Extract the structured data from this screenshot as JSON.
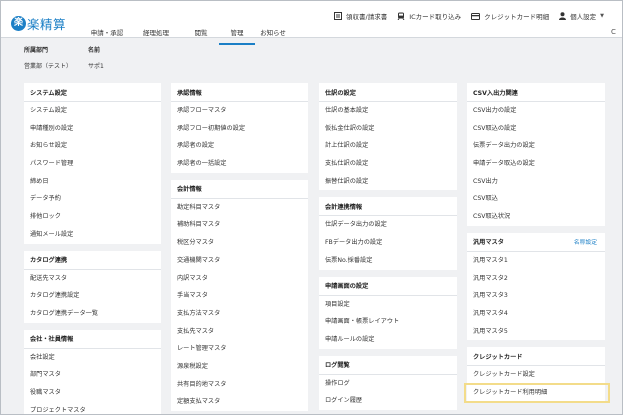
{
  "app": {
    "logo_mark": "楽",
    "logo_text": "楽精算"
  },
  "main_nav": [
    {
      "label": "申請・承認"
    },
    {
      "label": "経理処理"
    },
    {
      "label": "閲覧"
    },
    {
      "label": "管理",
      "active": true
    },
    {
      "label": "お知らせ"
    }
  ],
  "top_links": {
    "receipts": "領収書/請求書",
    "ic_card": "ICカード取り込み",
    "credit_card": "クレジットカード明細",
    "personal": "個人設定"
  },
  "refresh_icon": "C",
  "user_info": {
    "dept_label": "所属部門",
    "name_label": "名前",
    "dept_value": "営業部（テスト）",
    "name_value": "サポ1"
  },
  "columns": [
    {
      "panels": [
        {
          "title": "システム設定",
          "items": [
            "システム設定",
            "申請種別の設定",
            "お知らせ設定",
            "パスワード管理",
            "締め日",
            "データ予約",
            "排他ロック",
            "通知メール設定"
          ]
        },
        {
          "title": "カタログ連携",
          "items": [
            "配送先マスタ",
            "カタログ連携設定",
            "カタログ連携データ一覧"
          ]
        },
        {
          "title": "会社・社員情報",
          "items": [
            "会社設定",
            "部門マスタ",
            "役職マスタ",
            "プロジェクトマスタ"
          ]
        }
      ]
    },
    {
      "panels": [
        {
          "title": "承認情報",
          "items": [
            "承認フローマスタ",
            "承認フロー初期値の設定",
            "承認者の設定",
            "承認者の一括設定"
          ]
        },
        {
          "title": "会計情報",
          "items": [
            "勘定科目マスタ",
            "補助科目マスタ",
            "税区分マスタ",
            "交通機関マスタ",
            "内訳マスタ",
            "手当マスタ",
            "支払方法マスタ",
            "支払先マスタ",
            "レート管理マスタ",
            "源泉税設定",
            "共有目的地マスタ",
            "定額支払マスタ"
          ]
        }
      ]
    },
    {
      "panels": [
        {
          "title": "仕訳の設定",
          "items": [
            "仕訳の基本設定",
            "仮払金仕訳の設定",
            "計上仕訳の設定",
            "支払仕訳の設定",
            "振替仕訳の設定"
          ]
        },
        {
          "title": "会計連携情報",
          "items": [
            "仕訳データ出力の設定",
            "FBデータ出力の設定",
            "伝票No.採番設定"
          ]
        },
        {
          "title": "申請画面の設定",
          "items": [
            "項目設定",
            "申請画面・帳票レイアウト",
            "申請ルールの設定"
          ]
        },
        {
          "title": "ログ閲覧",
          "items": [
            "操作ログ",
            "ログイン履歴"
          ]
        }
      ]
    },
    {
      "panels": [
        {
          "title": "CSV入出力関連",
          "items": [
            "CSV出力の設定",
            "CSV取込の設定",
            "伝票データ出力の設定",
            "申請データ取込の設定",
            "CSV出力",
            "CSV取込",
            "CSV取込状況"
          ]
        },
        {
          "title": "汎用マスタ",
          "side_link": "名称設定",
          "items": [
            "汎用マスタ1",
            "汎用マスタ2",
            "汎用マスタ3",
            "汎用マスタ4",
            "汎用マスタ5"
          ]
        },
        {
          "title": "クレジットカード",
          "items": [
            "クレジットカード設定",
            "クレジットカード利用明細"
          ],
          "highlighted_item": 1
        }
      ]
    }
  ]
}
